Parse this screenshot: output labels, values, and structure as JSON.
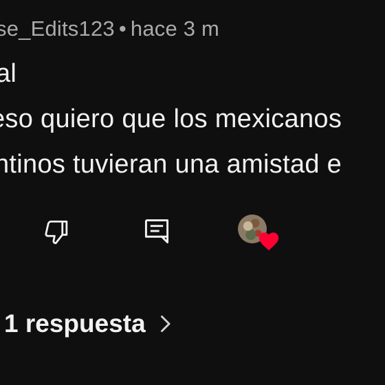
{
  "comment": {
    "author": "se_Edits123",
    "separator": "•",
    "time": "hace 3 m",
    "lines": [
      "al",
      "eso quiero que los mexicanos",
      "ntinos tuvieran una amistad e"
    ]
  },
  "actions": {
    "dislike_icon": "thumbs-down-icon",
    "reply_icon": "comment-reply-icon",
    "creator_heart_icon": "heart-icon",
    "heart_color": "#ff0033"
  },
  "replies": {
    "label": "1 respuesta",
    "chevron_icon": "chevron-right-icon"
  }
}
